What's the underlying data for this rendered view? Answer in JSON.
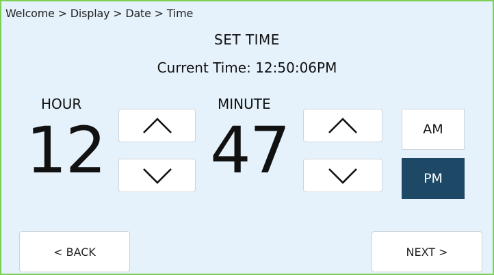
{
  "breadcrumb": "Welcome > Display > Date > Time",
  "title": "SET TIME",
  "current_time": "Current Time: 12:50:06PM",
  "hour": {
    "label": "HOUR",
    "value": "12"
  },
  "minute": {
    "label": "MINUTE",
    "value": "47"
  },
  "meridiem": {
    "am_label": "AM",
    "pm_label": "PM",
    "selected": "PM"
  },
  "nav": {
    "back_label": "< BACK",
    "next_label": "NEXT >"
  },
  "icons": {
    "up": "chevron-up-icon",
    "down": "chevron-down-icon"
  },
  "colors": {
    "background": "#e6f2fb",
    "border": "#7ccf52",
    "selected": "#1d4966"
  }
}
